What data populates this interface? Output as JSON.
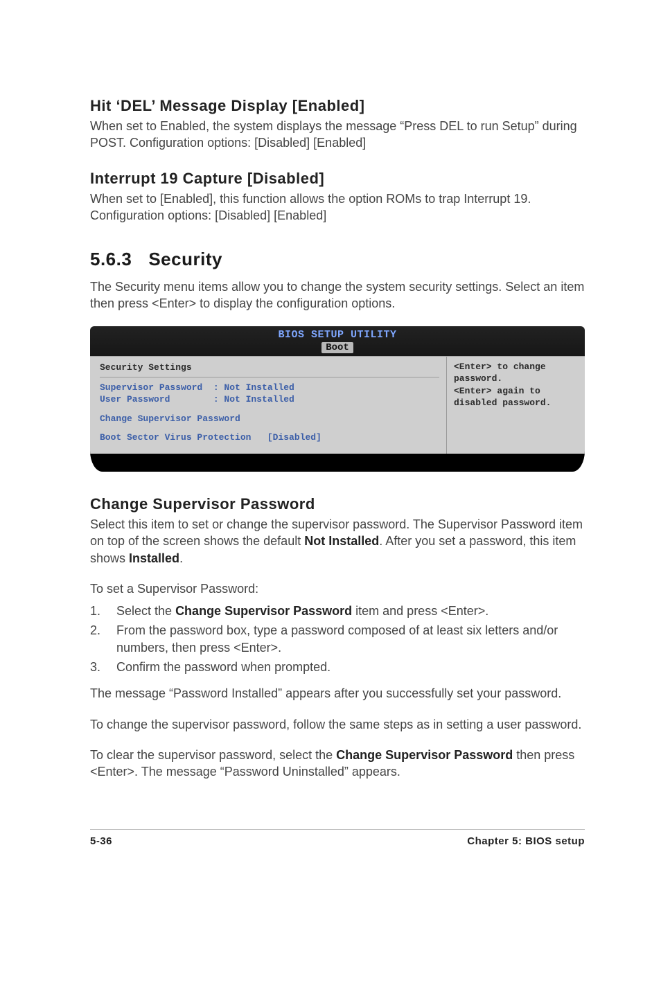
{
  "sections": {
    "hit_del": {
      "heading": "Hit ‘DEL’ Message Display [Enabled]",
      "body": "When set to Enabled, the system displays the message “Press DEL to run Setup” during POST. Configuration options: [Disabled] [Enabled]"
    },
    "int19": {
      "heading": "Interrupt 19 Capture [Disabled]",
      "body": "When set to [Enabled], this function allows the option ROMs to trap Interrupt 19. Configuration options: [Disabled] [Enabled]"
    },
    "security": {
      "num": "5.6.3",
      "title": "Security",
      "intro": "The Security menu items allow you to change the system security settings. Select an item then press <Enter> to display the configuration options."
    },
    "change_sup": {
      "heading": "Change Supervisor Password",
      "p1_a": "Select this item to set or change the supervisor password. The Supervisor Password item on top of the screen shows the default ",
      "p1_b": "Not Installed",
      "p1_c": ". After you set a password, this item shows ",
      "p1_d": "Installed",
      "p1_e": ".",
      "p2": "To set a Supervisor Password:",
      "steps": [
        {
          "n": "1.",
          "pre": "Select the ",
          "bold": "Change Supervisor Password",
          "post": " item and press <Enter>."
        },
        {
          "n": "2.",
          "pre": "From the password box, type a password composed of at least six letters and/or numbers, then press <Enter>.",
          "bold": "",
          "post": ""
        },
        {
          "n": "3.",
          "pre": "Confirm the password when prompted.",
          "bold": "",
          "post": ""
        }
      ],
      "p3": "The message “Password Installed” appears after you successfully set your password.",
      "p4": "To change the supervisor password, follow the same steps as in setting a user password.",
      "p5_a": "To clear the supervisor password, select the ",
      "p5_b": "Change Supervisor Password",
      "p5_c": " then press <Enter>. The message “Password Uninstalled” appears."
    }
  },
  "bios": {
    "title": "BIOS SETUP UTILITY",
    "tab": "Boot",
    "left": {
      "header": "Security Settings",
      "line1": "Supervisor Password  : Not Installed",
      "line2": "User Password        : Not Installed",
      "line3": "Change Supervisor Password",
      "line4": "Boot Sector Virus Protection   [Disabled]"
    },
    "right": "<Enter> to change password.\n<Enter> again to disabled password."
  },
  "footer": {
    "left": "5-36",
    "right": "Chapter 5: BIOS setup"
  }
}
